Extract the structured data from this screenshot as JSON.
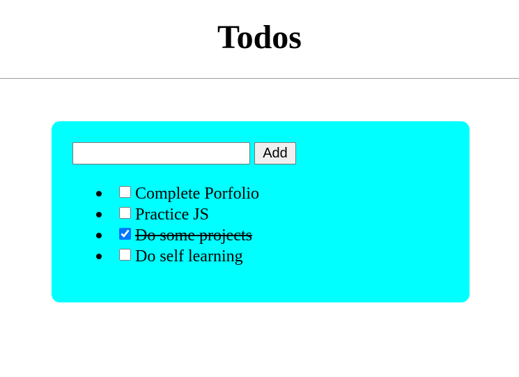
{
  "header": {
    "title": "Todos"
  },
  "form": {
    "input_value": "",
    "placeholder": "",
    "add_label": "Add"
  },
  "todos": [
    {
      "text": "Complete Porfolio",
      "done": false
    },
    {
      "text": "Practice JS",
      "done": false
    },
    {
      "text": "Do some projects",
      "done": true
    },
    {
      "text": "Do self learning",
      "done": false
    }
  ],
  "colors": {
    "card_background": "#00ffff",
    "checkbox_accent": "#0075ff",
    "divider": "#9a9a9a"
  }
}
